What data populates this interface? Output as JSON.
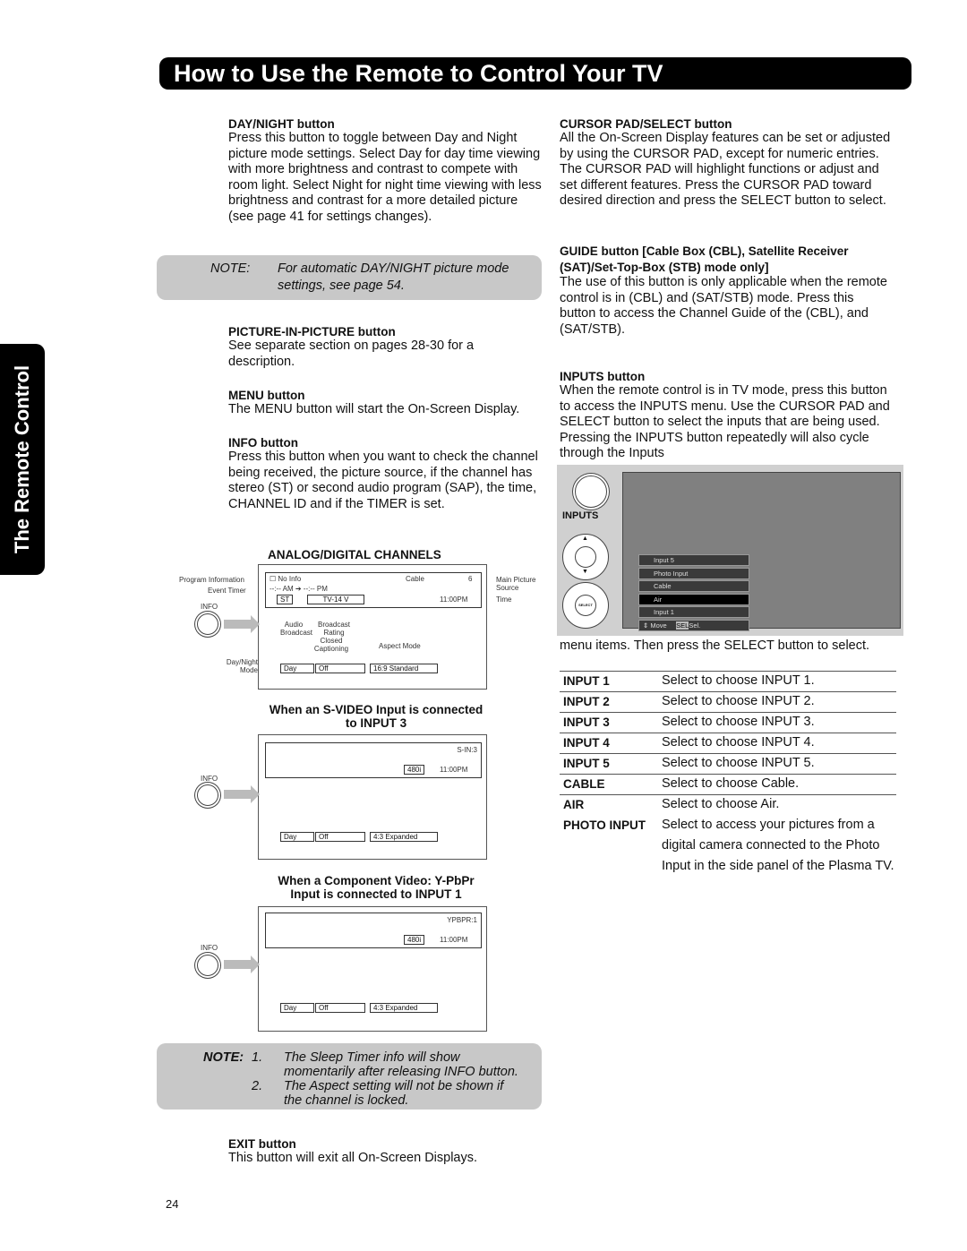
{
  "header": {
    "title": "How to Use the Remote to Control Your TV"
  },
  "side_tab": "The Remote Control",
  "left": {
    "daynight": {
      "title": "DAY/NIGHT button",
      "body": "Press this button to toggle between Day and Night picture mode settings.  Select Day for day time viewing with more brightness and contrast to compete with room light.  Select Night for night time viewing with less brightness and contrast for a more detailed picture (see page 41 for settings changes)."
    },
    "note1": {
      "label": "NOTE:",
      "line1": "For automatic DAY/NIGHT picture mode",
      "line2": "settings, see page 54."
    },
    "pip": {
      "title": "PICTURE-IN-PICTURE button",
      "body": "See separate section on pages 28-30 for a description."
    },
    "menu": {
      "title": "MENU button",
      "body": "The MENU button will start the On-Screen Display."
    },
    "info": {
      "title": "INFO button",
      "body": "Press this button when you want to check the channel being received, the picture source, if the channel has stereo (ST) or second audio program (SAP), the time, CHANNEL ID and if the TIMER is set."
    },
    "diagram1": {
      "title": "ANALOG/DIGITAL CHANNELS",
      "program_info_label": "Program Information",
      "event_timer_label": "Event Timer",
      "info_label": "INFO",
      "daynight_label": "Day/Night Mode",
      "main_source_label": "Main Picture Source",
      "time_label": "Time",
      "audio_label": "Audio Broadcast",
      "rating_label": "Broadcast Rating",
      "cc_label": "Closed Captioning",
      "aspect_label": "Aspect Mode",
      "no_info": "No Info",
      "source": "Cable",
      "channel": "6",
      "timer": "--:-- AM ➔ --:-- PM",
      "audio": "ST",
      "rating": "TV-14 V",
      "time": "11:00PM",
      "day": "Day",
      "cc": "Off",
      "aspect": "16:9 Standard"
    },
    "diagram2": {
      "title1": "When an S-VIDEO Input is connected",
      "title2": "to INPUT 3",
      "info_label": "INFO",
      "source": "S-IN:3",
      "res": "480i",
      "time": "11:00PM",
      "day": "Day",
      "cc": "Off",
      "aspect": "4:3 Expanded"
    },
    "diagram3": {
      "title1": "When a Component Video: Y-PbPr",
      "title2": "Input is connected to INPUT 1",
      "info_label": "INFO",
      "source": "YPBPR:1",
      "res": "480i",
      "time": "11:00PM",
      "day": "Day",
      "cc": "Off",
      "aspect": "4:3 Expanded"
    },
    "note2": {
      "label": "NOTE:",
      "n1": "1.",
      "t1a": "The Sleep Timer info will show",
      "t1b": "momentarily after releasing INFO button.",
      "n2": "2.",
      "t2a": "The Aspect setting will not be shown if",
      "t2b": "the channel is locked."
    },
    "exit": {
      "title": "EXIT button",
      "body": "This button will exit all On-Screen Displays."
    }
  },
  "right": {
    "cursor": {
      "title": "CURSOR PAD/SELECT button",
      "body": "All the On-Screen Display features can be set or adjusted by using the CURSOR PAD, except for numeric entries.  The CURSOR PAD will highlight functions or adjust and set different features.  Press the CURSOR PAD toward desired direction and press the SELECT button to select."
    },
    "guide": {
      "title": "GUIDE button [Cable Box (CBL), Satellite Receiver (SAT)/Set-Top-Box (STB) mode only]",
      "body": "The use of this button is only applicable when the remote control is in (CBL) and (SAT/STB) mode.  Press this button to access the Channel Guide of the (CBL), and (SAT/STB)."
    },
    "inputs": {
      "title": "INPUTS button",
      "body": "When the remote control is in TV mode, press this button to access the INPUTS menu.  Use the CURSOR PAD and SELECT button to select the inputs that are being used.  Pressing the INPUTS button repeatedly will also cycle through the Inputs",
      "body2": "menu items.  Then press the SELECT button to select."
    },
    "inputs_diagram": {
      "inputs_label": "INPUTS",
      "select_label": "SELECT",
      "menu": [
        "Input 5",
        "Photo Input",
        "Cable",
        "Air",
        "Input 1"
      ],
      "selected": "Air",
      "footer_move": "Move",
      "footer_sel": "SEL",
      "footer_sel2": "Sel."
    },
    "table": [
      {
        "k": "INPUT 1",
        "v": "Select to choose INPUT 1."
      },
      {
        "k": "INPUT 2",
        "v": "Select to choose INPUT 2."
      },
      {
        "k": "INPUT 3",
        "v": "Select to choose INPUT 3."
      },
      {
        "k": "INPUT 4",
        "v": "Select to choose INPUT 4."
      },
      {
        "k": "INPUT 5",
        "v": "Select to choose INPUT 5."
      },
      {
        "k": "CABLE",
        "v": "Select to choose Cable."
      },
      {
        "k": "AIR",
        "v": "Select to choose Air."
      },
      {
        "k": "PHOTO INPUT",
        "v": "Select to access your pictures from a digital camera connected to the Photo Input in the side panel of the Plasma TV."
      }
    ]
  },
  "page_number": "24"
}
